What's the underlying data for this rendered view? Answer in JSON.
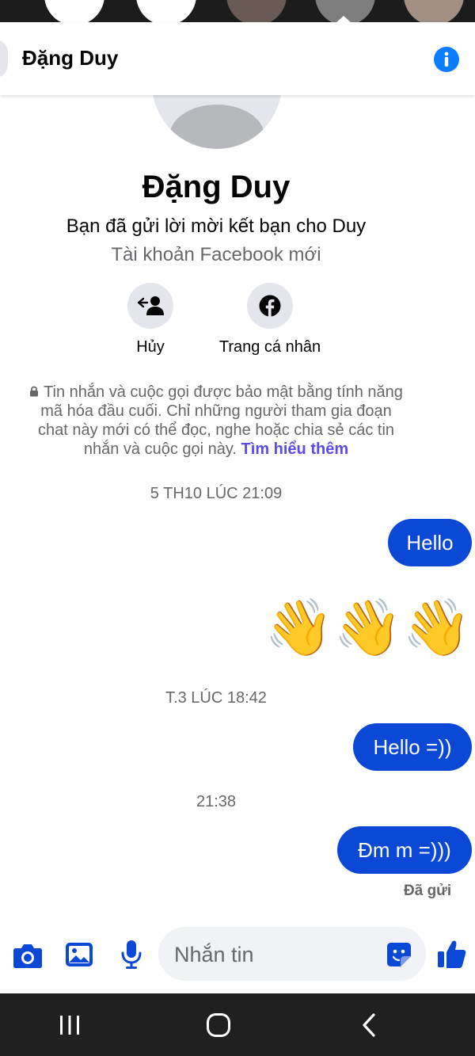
{
  "header": {
    "title": "Đặng Duy"
  },
  "profile": {
    "name": "Đặng Duy",
    "friend_request_note": "Bạn đã gửi lời mời kết bạn cho Duy",
    "account_note": "Tài khoản Facebook mới",
    "actions": [
      {
        "label": "Hủy",
        "icon": "cancel-friend-request-icon"
      },
      {
        "label": "Trang cá nhân",
        "icon": "facebook-icon"
      }
    ]
  },
  "e2ee_notice": {
    "text": "Tin nhắn và cuộc gọi được bảo mật bằng tính năng mã hóa đầu cuối. Chỉ những người tham gia đoạn chat này mới có thể đọc, nghe hoặc chia sẻ các tin nhắn và cuộc gọi này.",
    "link": "Tìm hiểu thêm"
  },
  "messages": {
    "ts1": "5 TH10 LÚC 21:09",
    "msg1": "Hello",
    "wave_emojis": "👋👋👋",
    "ts2": "T.3 LÚC 18:42",
    "msg2": "Hello =))",
    "ts3": "21:38",
    "msg3": "Đm m =)))",
    "status": "Đã gửi"
  },
  "composer": {
    "placeholder": "Nhắn tin",
    "icons": [
      "camera-icon",
      "gallery-icon",
      "microphone-icon",
      "sticker-icon",
      "thumbs-up-icon"
    ]
  },
  "colors": {
    "accent": "#0b48d6",
    "info_blue": "#0a7cff",
    "link_purple": "#5b4ce6",
    "muted_text": "#65676b",
    "button_bg": "#e4e6eb"
  }
}
